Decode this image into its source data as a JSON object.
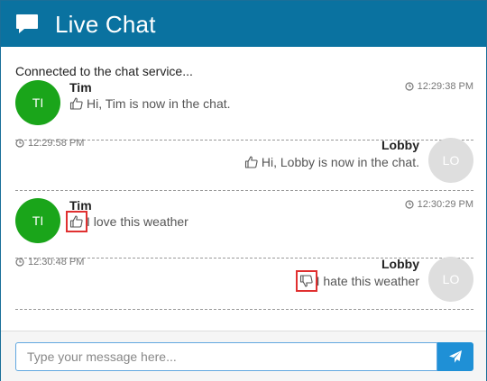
{
  "header": {
    "title": "Live Chat",
    "icon": "chat-bubble-icon"
  },
  "chat": {
    "status": "Connected to the chat service...",
    "messages": [
      {
        "side": "left",
        "avatar": "TI",
        "avatar_color": "#1aa51a",
        "name": "Tim",
        "time": "12:29:38 PM",
        "icon": "thumbs-up-icon",
        "text": "Hi, Tim is now in the chat."
      },
      {
        "side": "right",
        "avatar": "LO",
        "avatar_color": "#dedede",
        "name": "Lobby",
        "time": "12:29:58 PM",
        "icon": "thumbs-up-icon",
        "text": "Hi, Lobby is now in the chat."
      },
      {
        "side": "left",
        "avatar": "TI",
        "avatar_color": "#1aa51a",
        "name": "Tim",
        "time": "12:30:29 PM",
        "icon": "thumbs-up-icon",
        "text": "I love this weather"
      },
      {
        "side": "right",
        "avatar": "LO",
        "avatar_color": "#dedede",
        "name": "Lobby",
        "time": "12:30:48 PM",
        "icon": "thumbs-down-icon",
        "text": "I hate this weather"
      }
    ]
  },
  "footer": {
    "placeholder": "Type your message here...",
    "value": "",
    "send_icon": "paper-plane-icon"
  },
  "colors": {
    "header_bg": "#0a72a0",
    "send_button": "#1f90d6",
    "highlight_box": "#e03030"
  }
}
